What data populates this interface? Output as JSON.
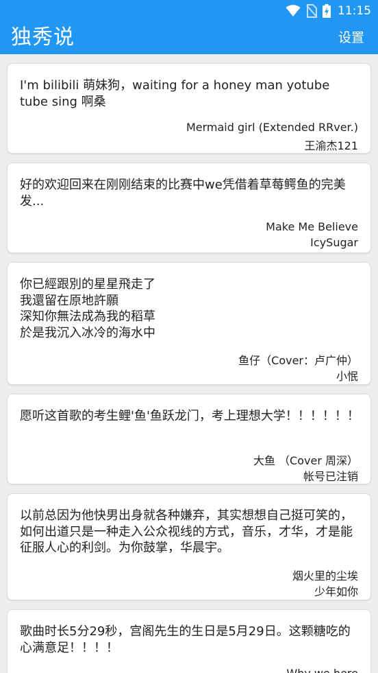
{
  "status": {
    "time": "11:15",
    "icons": [
      "wifi-icon",
      "no-sim-icon",
      "battery-charging-icon"
    ]
  },
  "app": {
    "title": "独秀说",
    "settings_label": "设置"
  },
  "colors": {
    "primary": "#2196f3",
    "card": "#ffffff",
    "background": "#eeeeee"
  },
  "posts": [
    {
      "text": "I'm bilibili 萌妹狗，waiting for a honey man yotube tube sing 啊桑",
      "song": "Mermaid girl (Extended RRver.)",
      "user": "王渝杰121"
    },
    {
      "text": "好的欢迎回来在刚刚结束的比赛中we凭借着草莓鳄鱼的完美发...",
      "song": "Make Me Believe",
      "user": "IcySugar"
    },
    {
      "text": "你已經跟別的星星飛走了\n我還留在原地許願\n深知你無法成為我的稻草\n於是我沉入冰冷的海水中",
      "song": "鱼仔（Cover：卢广仲）",
      "user": "小怋"
    },
    {
      "text": "愿听这首歌的考生鲤'鱼'鱼跃龙门，考上理想大学！！！！！！",
      "song": "大鱼 （Cover 周深）",
      "user": "帐号已注销"
    },
    {
      "text": "以前总因为他快男出身就各种嫌弃，其实想想自己挺可笑的，如何出道只是一种走入公众视线的方式，音乐，才华，才是能征服人心的利剑。为你鼓掌，华晨宇。",
      "song": "烟火里的尘埃",
      "user": "少年如你"
    },
    {
      "text": "歌曲时长5分29秒，宫阁先生的生日是5月29日。这颗糖吃的心满意足！！！！",
      "song": "Why we here",
      "user": ""
    }
  ]
}
